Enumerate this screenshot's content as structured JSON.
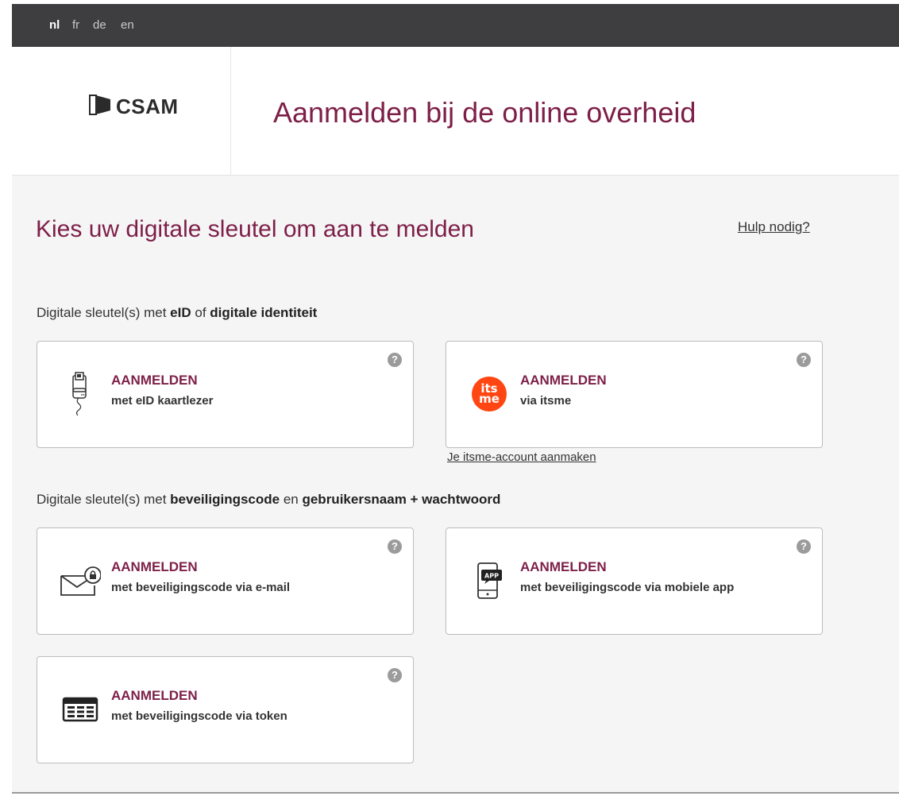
{
  "languages": [
    {
      "code": "nl",
      "active": true
    },
    {
      "code": "fr",
      "active": false
    },
    {
      "code": "de",
      "active": false
    },
    {
      "code": "en",
      "active": false
    }
  ],
  "header": {
    "logo_text": "CSAM",
    "title": "Aanmelden bij de online overheid"
  },
  "main": {
    "title": "Kies uw digitale sleutel om aan te melden",
    "help_link": "Hulp nodig?",
    "group1": {
      "prefix": "Digitale sleutel(s) met ",
      "bold1": "eID",
      "mid": " of ",
      "bold2": "digitale identiteit"
    },
    "group2": {
      "prefix": "Digitale sleutel(s) met ",
      "bold1": "beveiligingscode",
      "mid": " en ",
      "bold2": "gebruikersnaam + wachtwoord"
    },
    "cards": [
      {
        "action": "AANMELDEN",
        "desc": "met eID kaartlezer",
        "icon": "card-reader-icon"
      },
      {
        "action": "AANMELDEN",
        "desc": "via itsme",
        "icon": "itsme-icon",
        "icon_text_top": "its",
        "icon_text_bottom": "me"
      },
      {
        "action": "AANMELDEN",
        "desc": "met beveiligingscode via e-mail",
        "icon": "email-lock-icon"
      },
      {
        "action": "AANMELDEN",
        "desc": "met beveiligingscode via mobiele app",
        "icon": "mobile-app-icon",
        "icon_text": "APP"
      },
      {
        "action": "AANMELDEN",
        "desc": "met beveiligingscode via token",
        "icon": "token-icon"
      }
    ],
    "help_icon_glyph": "?",
    "itsme_account_link": "Je itsme-account aanmaken"
  },
  "colors": {
    "brand": "#7d1f48",
    "topbar": "#3e3e40",
    "itsme": "#ff4612"
  }
}
